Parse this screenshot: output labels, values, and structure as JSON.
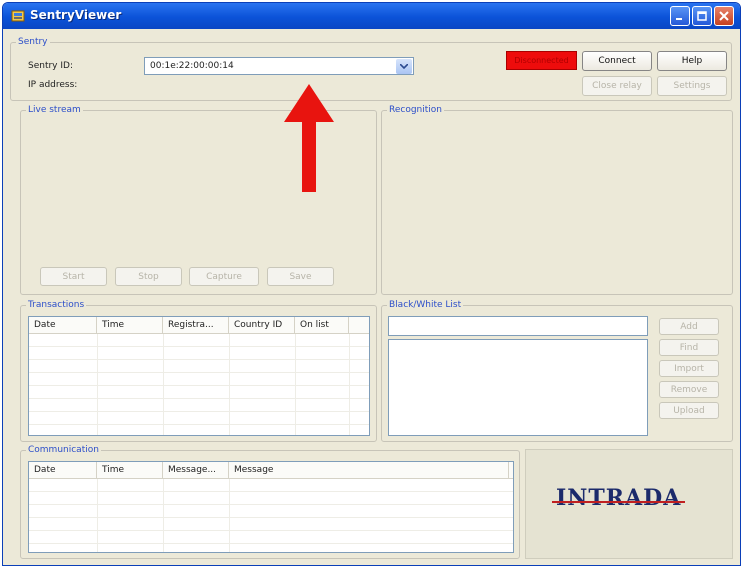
{
  "window": {
    "title": "SentryViewer"
  },
  "sentry": {
    "legend": "Sentry",
    "sentry_id_label": "Sentry ID:",
    "sentry_id_value": "00:1e:22:00:00:14",
    "ip_label": "IP address:",
    "status": "Disconnected",
    "connect_label": "Connect",
    "help_label": "Help",
    "close_relay_label": "Close relay",
    "settings_label": "Settings"
  },
  "live_stream": {
    "legend": "Live stream",
    "start_label": "Start",
    "stop_label": "Stop",
    "capture_label": "Capture",
    "save_label": "Save"
  },
  "recognition": {
    "legend": "Recognition"
  },
  "transactions": {
    "legend": "Transactions",
    "columns": [
      "Date",
      "Time",
      "Registra...",
      "Country ID",
      "On list"
    ]
  },
  "black_white_list": {
    "legend": "Black/White List",
    "add_label": "Add",
    "find_label": "Find",
    "import_label": "Import",
    "remove_label": "Remove",
    "upload_label": "Upload"
  },
  "communication": {
    "legend": "Communication",
    "columns": [
      "Date",
      "Time",
      "Message...",
      "Message"
    ]
  },
  "logo_text": "INTRADA",
  "colors": {
    "status_red": "#ee0c0c",
    "titlebar_blue": "#0b52d8",
    "arrow_red": "#e8140f"
  }
}
